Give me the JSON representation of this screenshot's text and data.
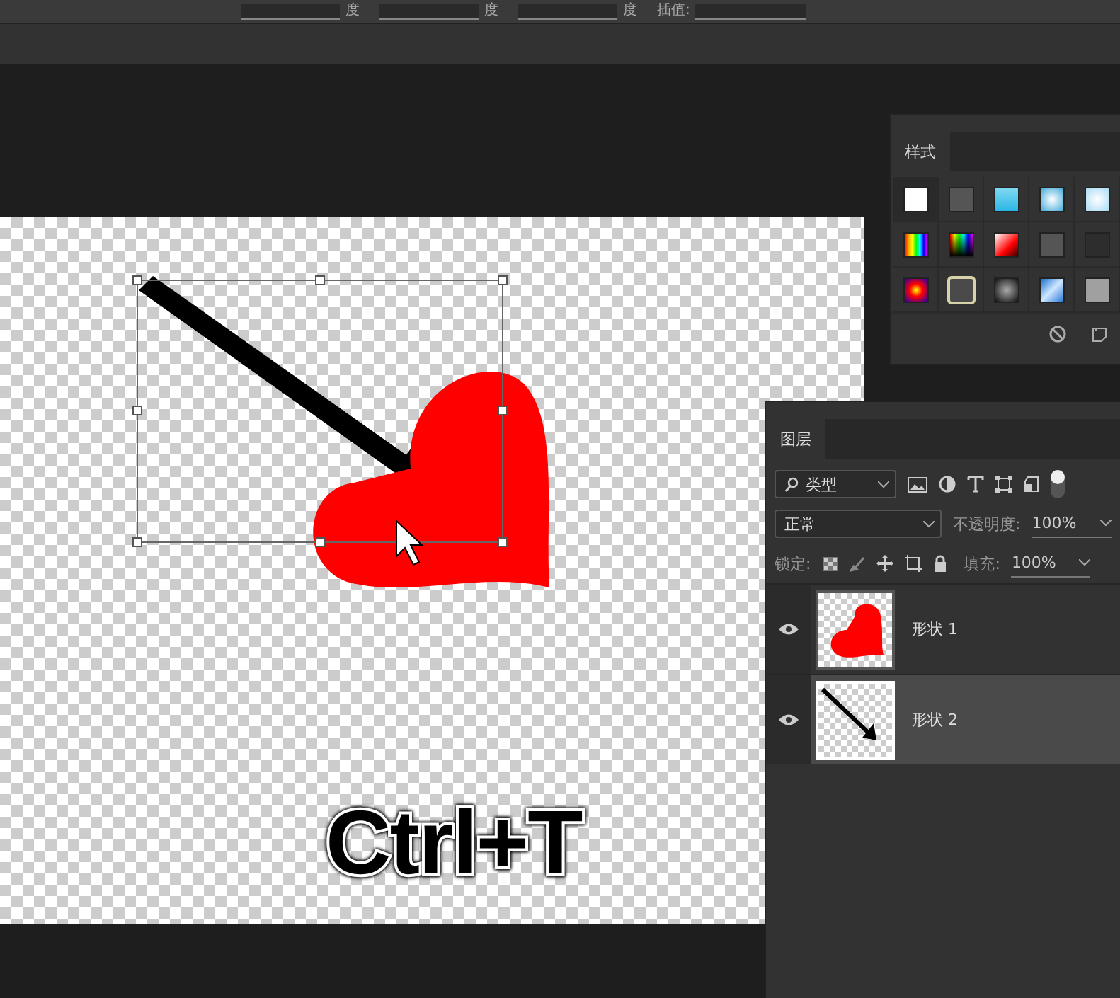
{
  "options_bar": {
    "items": [
      {
        "kind": "field",
        "label": "度"
      },
      {
        "kind": "field",
        "label": "度"
      },
      {
        "kind": "field",
        "label": "度"
      },
      {
        "kind": "select",
        "label": "插值:"
      }
    ]
  },
  "canvas": {
    "annotation": "Ctrl+T"
  },
  "styles_panel": {
    "tab": "样式",
    "swatches": [
      {
        "selected": false
      },
      {
        "selected": false
      },
      {
        "selected": false
      },
      {
        "selected": false
      },
      {
        "selected": false
      },
      {
        "selected": false
      },
      {
        "selected": false
      },
      {
        "selected": false
      },
      {
        "selected": false
      },
      {
        "selected": false
      },
      {
        "selected": false
      },
      {
        "selected": true
      },
      {
        "selected": false
      },
      {
        "selected": false
      },
      {
        "selected": false
      }
    ]
  },
  "layers_panel": {
    "tab": "图层",
    "filter": "类型",
    "filter_on": true,
    "blend_mode": "正常",
    "opacity_label": "不透明度:",
    "opacity": "100%",
    "lock_label": "锁定:",
    "fill_label": "填充:",
    "fill": "100%",
    "layers": [
      {
        "name": "形状 1",
        "kind": "heart",
        "visible": true,
        "selected": false
      },
      {
        "name": "形状 2",
        "kind": "arrow",
        "visible": true,
        "selected": true
      }
    ]
  }
}
